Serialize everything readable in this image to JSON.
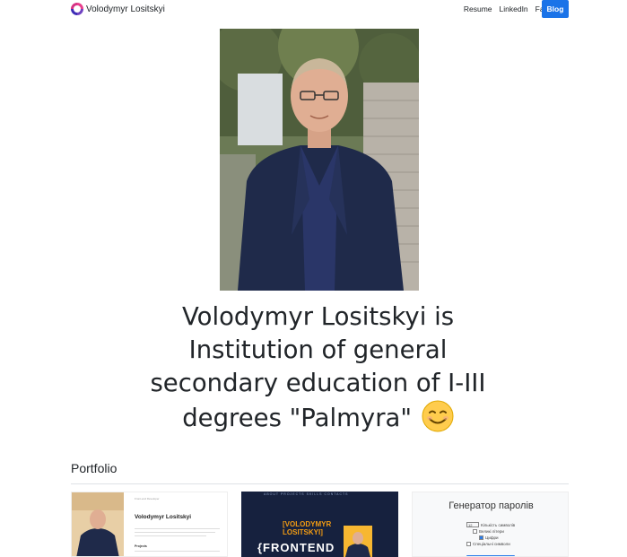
{
  "nav": {
    "brand": "Volodymyr Lositskyi",
    "links": [
      "Resume",
      "LinkedIn",
      "Facebook"
    ],
    "blog": "Blog"
  },
  "hero": {
    "headline": "Volodymyr Lositskyi is Institution of general secondary education of I-III degrees \"Palmyra\"",
    "emoji_icon": "smiling-face-emoji"
  },
  "portfolio": {
    "title": "Portfolio",
    "cards": [
      {
        "small_text": "Front-end Developer",
        "name": "Volodymyr Lositskyi",
        "section": "Projects"
      },
      {
        "nav": "ABOUT  PROJECTS  SKILLS  CONTACTS",
        "title_line1": "[VOLODYMYR",
        "title_line2": "LOSITSKYI]",
        "big": "{FRONTEND"
      },
      {
        "title": "Генератор паролів",
        "length_value": "12",
        "length_label": "Кількість символів",
        "options": [
          "Великі літери",
          "Цифри",
          "Спеціальні символи"
        ]
      }
    ]
  },
  "colors": {
    "blog_button": "#1a73e8",
    "text": "#212529",
    "card2_bg": "#16213e"
  }
}
